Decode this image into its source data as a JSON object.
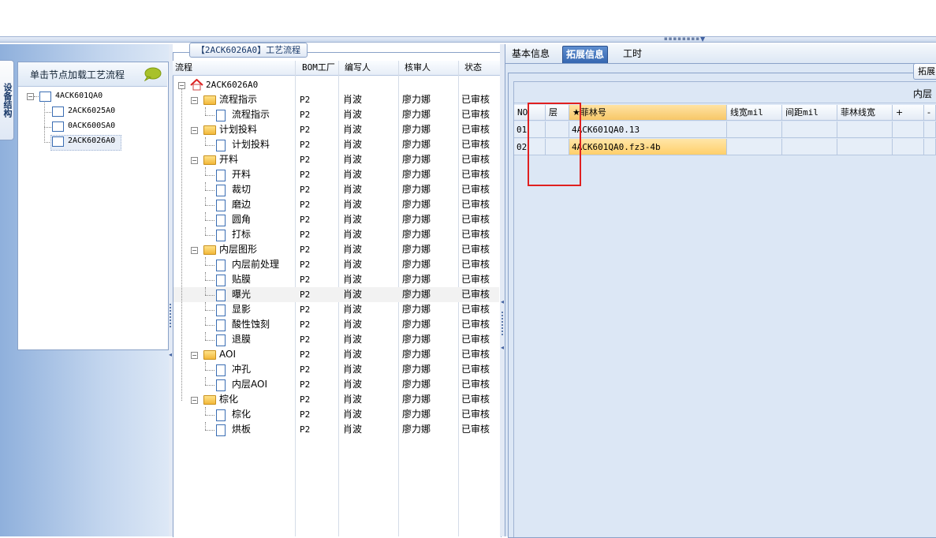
{
  "left": {
    "vtab_label": "设备结构",
    "header": "单击节点加载工艺流程",
    "tree": [
      {
        "label": "4ACK601QA0"
      },
      {
        "label": "2ACK6025A0"
      },
      {
        "label": "0ACK600SA0"
      },
      {
        "label": "2ACK6026A0"
      }
    ]
  },
  "middle": {
    "title": "【2ACK6026A0】工艺流程",
    "columns": [
      "流程",
      "BOM工厂",
      "编写人",
      "核审人",
      "状态"
    ],
    "root": "2ACK6026A0",
    "rows": [
      {
        "type": "folder",
        "name": "流程指示",
        "bom": "P2",
        "writer": "肖波",
        "reviewer": "廖力娜",
        "status": "已审核"
      },
      {
        "type": "doc",
        "name": "流程指示",
        "bom": "P2",
        "writer": "肖波",
        "reviewer": "廖力娜",
        "status": "已审核"
      },
      {
        "type": "folder",
        "name": "计划投料",
        "bom": "P2",
        "writer": "肖波",
        "reviewer": "廖力娜",
        "status": "已审核"
      },
      {
        "type": "doc",
        "name": "计划投料",
        "bom": "P2",
        "writer": "肖波",
        "reviewer": "廖力娜",
        "status": "已审核"
      },
      {
        "type": "folder",
        "name": "开料",
        "bom": "P2",
        "writer": "肖波",
        "reviewer": "廖力娜",
        "status": "已审核"
      },
      {
        "type": "doc",
        "name": "开料",
        "bom": "P2",
        "writer": "肖波",
        "reviewer": "廖力娜",
        "status": "已审核"
      },
      {
        "type": "doc",
        "name": "裁切",
        "bom": "P2",
        "writer": "肖波",
        "reviewer": "廖力娜",
        "status": "已审核"
      },
      {
        "type": "doc",
        "name": "磨边",
        "bom": "P2",
        "writer": "肖波",
        "reviewer": "廖力娜",
        "status": "已审核"
      },
      {
        "type": "doc",
        "name": "圆角",
        "bom": "P2",
        "writer": "肖波",
        "reviewer": "廖力娜",
        "status": "已审核"
      },
      {
        "type": "doc",
        "name": "打标",
        "bom": "P2",
        "writer": "肖波",
        "reviewer": "廖力娜",
        "status": "已审核"
      },
      {
        "type": "folder",
        "name": "内层图形",
        "bom": "P2",
        "writer": "肖波",
        "reviewer": "廖力娜",
        "status": "已审核"
      },
      {
        "type": "doc",
        "name": "内层前处理",
        "bom": "P2",
        "writer": "肖波",
        "reviewer": "廖力娜",
        "status": "已审核"
      },
      {
        "type": "doc",
        "name": "贴膜",
        "bom": "P2",
        "writer": "肖波",
        "reviewer": "廖力娜",
        "status": "已审核"
      },
      {
        "type": "doc",
        "name": "曝光",
        "bom": "P2",
        "writer": "肖波",
        "reviewer": "廖力娜",
        "status": "已审核",
        "selected": true
      },
      {
        "type": "doc",
        "name": "显影",
        "bom": "P2",
        "writer": "肖波",
        "reviewer": "廖力娜",
        "status": "已审核"
      },
      {
        "type": "doc",
        "name": "酸性蚀刻",
        "bom": "P2",
        "writer": "肖波",
        "reviewer": "廖力娜",
        "status": "已审核"
      },
      {
        "type": "doc",
        "name": "退膜",
        "bom": "P2",
        "writer": "肖波",
        "reviewer": "廖力娜",
        "status": "已审核"
      },
      {
        "type": "folder",
        "name": "AOI",
        "bom": "P2",
        "writer": "肖波",
        "reviewer": "廖力娜",
        "status": "已审核"
      },
      {
        "type": "doc",
        "name": "冲孔",
        "bom": "P2",
        "writer": "肖波",
        "reviewer": "廖力娜",
        "status": "已审核"
      },
      {
        "type": "doc",
        "name": "内层AOI",
        "bom": "P2",
        "writer": "肖波",
        "reviewer": "廖力娜",
        "status": "已审核"
      },
      {
        "type": "folder",
        "name": "棕化",
        "bom": "P2",
        "writer": "肖波",
        "reviewer": "廖力娜",
        "status": "已审核"
      },
      {
        "type": "doc",
        "name": "棕化",
        "bom": "P2",
        "writer": "肖波",
        "reviewer": "廖力娜",
        "status": "已审核"
      },
      {
        "type": "doc",
        "name": "烘板",
        "bom": "P2",
        "writer": "肖波",
        "reviewer": "廖力娜",
        "status": "已审核"
      }
    ]
  },
  "right": {
    "tabs": [
      "基本信息",
      "拓展信息",
      "工时"
    ],
    "active_tab": "拓展信息",
    "side_button": "拓展",
    "group_label": "内层",
    "grid_columns": [
      "NO",
      "层",
      "★菲林号",
      "线宽mil",
      "间距mil",
      "菲林线宽",
      "+",
      "-"
    ],
    "grid_rows": [
      {
        "no": "01",
        "layer": "",
        "film": "4ACK601QA0.13"
      },
      {
        "no": "02",
        "layer": "",
        "film": "4ACK601QA0.fz3-4b"
      }
    ]
  },
  "colors": {
    "accent": "#3566b0",
    "highlight_cell": "#ffcf6a",
    "annotation_box": "#e02020"
  }
}
